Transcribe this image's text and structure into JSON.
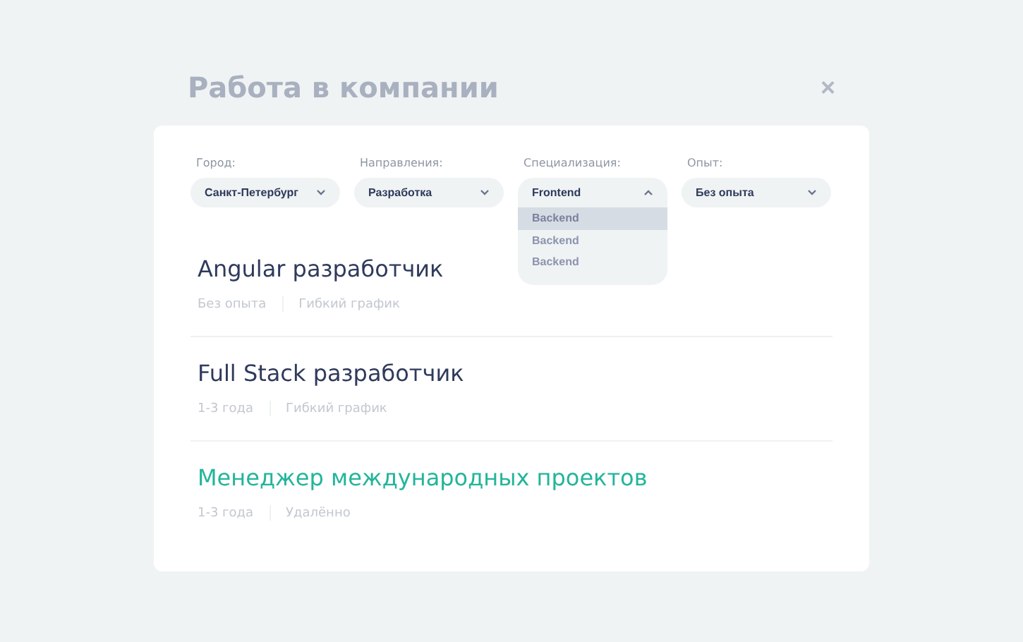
{
  "title": "Работа в компании",
  "close": "×",
  "filters": [
    {
      "label": "Город:",
      "value": "Санкт-Петербург",
      "expanded": false
    },
    {
      "label": "Направления:",
      "value": "Разработка",
      "expanded": false
    },
    {
      "label": "Специализация:",
      "value": "Frontend",
      "expanded": true,
      "options": [
        {
          "label": "Backend",
          "selected": true
        },
        {
          "label": "Backend",
          "selected": false
        },
        {
          "label": "Backend",
          "selected": false
        }
      ]
    },
    {
      "label": "Опыт:",
      "value": "Без опыта",
      "expanded": false
    }
  ],
  "jobs": [
    {
      "title": "Angular разработчик",
      "experience": "Без опыта",
      "schedule": "Гибкий график",
      "selected": false
    },
    {
      "title": "Full Stack разработчик",
      "experience": "1-3 года",
      "schedule": "Гибкий график",
      "selected": false
    },
    {
      "title": "Менеджер международных проектов",
      "experience": "1-3 года",
      "schedule": "Удалённо",
      "selected": true
    }
  ]
}
